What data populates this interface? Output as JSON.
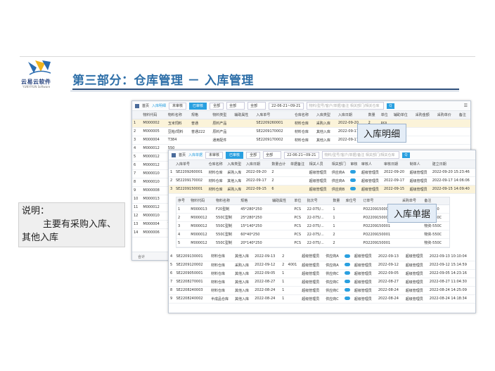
{
  "slide": {
    "title": "第三部分：仓库管理 － 入库管理",
    "logo_brand": "云易云软件",
    "logo_sub": "YUNYIYUN Software",
    "note_line1": "说明：",
    "note_line2": "主要有采购入库、",
    "note_line3": "其他入库",
    "callout_detail": "入库明细",
    "callout_doc": "入库单据"
  },
  "win1": {
    "tab_home": "首页",
    "tab_current": "入库明细",
    "btn_pending": "未审核",
    "btn_approved": "已审核",
    "btn_all": "全部",
    "sel_a": "全部",
    "sel_b": "全部",
    "date_range": "22-06-21~09-21",
    "search_placeholder": "物料/型号/客户/单据/备注  相关部门/相关仓库",
    "search_btn": "Q",
    "footer": "合计",
    "columns": [
      "",
      "物料代码",
      "物料名称",
      "规格",
      "物料类型",
      "辅助属性",
      "入库单号",
      "仓库名称",
      "入库类型",
      "入库日期",
      "数量",
      "单位",
      "辅助单位",
      "采购金额",
      "采购单价",
      "备注"
    ],
    "rows": [
      [
        "1",
        "M000002",
        "玉米饲料",
        "普通",
        "原料产品",
        "",
        "SE2209260001",
        "材料仓库",
        "采购入库",
        "2022-09-20",
        "2",
        "pcs",
        "",
        "",
        "",
        ""
      ],
      [
        "2",
        "M000005",
        "豆粕/饲料",
        "普通222",
        "原料产品",
        "",
        "SE2209170002",
        "材料仓库",
        "其他入库",
        "2022-09-17",
        "1",
        "pcs",
        "",
        "",
        "",
        ""
      ],
      [
        "3",
        "M000004",
        "T384",
        "",
        "通用配件",
        "",
        "SE2209170002",
        "材料仓库",
        "其他入库",
        "2022-09-17",
        "1",
        "kg",
        "",
        "",
        "",
        ""
      ],
      [
        "4",
        "M000012",
        "550",
        "",
        "",
        "",
        "",
        "",
        "",
        "",
        "",
        "",
        "",
        "",
        "",
        ""
      ],
      [
        "5",
        "M000012",
        "550",
        "",
        "",
        "",
        "",
        "",
        "",
        "",
        "",
        "",
        "",
        "",
        "",
        ""
      ],
      [
        "6",
        "M000012",
        "550",
        "",
        "",
        "",
        "",
        "",
        "",
        "",
        "",
        "",
        "",
        "",
        "",
        ""
      ],
      [
        "7",
        "M000010",
        "F20",
        "",
        "",
        "",
        "",
        "",
        "",
        "",
        "",
        "",
        "",
        "",
        "",
        ""
      ],
      [
        "8",
        "M000010",
        "F20",
        "",
        "",
        "",
        "",
        "",
        "",
        "",
        "",
        "",
        "",
        "",
        "",
        ""
      ],
      [
        "9",
        "M000008",
        "DS2",
        "",
        "",
        "",
        "",
        "",
        "",
        "",
        "",
        "",
        "",
        "",
        "",
        ""
      ],
      [
        "10",
        "M000013",
        "内六",
        "",
        "",
        "",
        "",
        "",
        "",
        "",
        "",
        "",
        "",
        "",
        "",
        ""
      ],
      [
        "11",
        "M000012",
        "调整",
        "",
        "",
        "",
        "",
        "",
        "",
        "",
        "",
        "",
        "",
        "",
        "",
        ""
      ],
      [
        "12",
        "M000010",
        "F20",
        "",
        "",
        "",
        "",
        "",
        "",
        "",
        "",
        "",
        "",
        "",
        "",
        ""
      ],
      [
        "13",
        "M000004",
        "T38",
        "",
        "",
        "",
        "",
        "",
        "",
        "",
        "",
        "",
        "",
        "",
        "",
        ""
      ],
      [
        "14",
        "M000006",
        "4CR",
        "",
        "",
        "",
        "",
        "",
        "",
        "",
        "",
        "",
        "",
        "",
        "",
        ""
      ]
    ]
  },
  "win2": {
    "tab_home": "首页",
    "tab_current": "入库单据",
    "btn_pending": "未审核",
    "btn_approved": "已审核",
    "btn_all": "全部",
    "sel_a": "全部",
    "date_range": "22-06-21~09-21",
    "search_placeholder": "物料/型号/客户/单据/备注  相关部门/相关仓库",
    "search_btn": "Q",
    "columns": [
      "",
      "入库单号",
      "仓库名称",
      "入库类型",
      "入库日期",
      "数量合计",
      "单据备注",
      "相关人员",
      "相关部门",
      "审核",
      "审核人",
      "审核日期",
      "制单人",
      "建立日期"
    ],
    "rows_top": [
      [
        "1",
        "SE2209260001",
        "材料仓库",
        "采购入库",
        "2022-09-20",
        "2",
        "",
        "超级管理员",
        "供应商A",
        "on",
        "超级管理员",
        "2022-09-20",
        "超级管理员",
        "2022-09-20 15:23:46"
      ],
      [
        "2",
        "SE2209170002",
        "材料仓库",
        "其他入库",
        "2022-09-17",
        "2",
        "",
        "超级管理员",
        "供应商A",
        "on",
        "超级管理员",
        "2022-09-17",
        "超级管理员",
        "2022-09-17 14:06:06"
      ],
      [
        "3",
        "SE2209150001",
        "材料仓库",
        "采购入库",
        "2022-09-15",
        "6",
        "",
        "超级管理员",
        "供应商B",
        "on",
        "超级管理员",
        "2022-09-15",
        "超级管理员",
        "2022-09-15 14:09:40"
      ]
    ],
    "sub_columns": [
      "序号",
      "物料代码",
      "物料名称",
      "规格",
      "辅助属性",
      "单位",
      "批次号",
      "数量",
      "库位号",
      "订单号",
      "采购单号",
      "备注"
    ],
    "sub_rows": [
      [
        "1",
        "M000013",
        "F20型制",
        "45*280*250",
        "",
        "PCS",
        "22-075/...",
        "1",
        "",
        "PO2209150001",
        "",
        "物资-550"
      ],
      [
        "2",
        "M000012",
        "550C型制",
        "25*280*250",
        "",
        "PCS",
        "22-075/...",
        "1",
        "",
        "PO2209150001",
        "",
        "物资-550C"
      ],
      [
        "3",
        "M000012",
        "550C型制",
        "15*140*250",
        "",
        "PCS",
        "22-075/...",
        "1",
        "",
        "PO2209150001",
        "",
        "物资-550C"
      ],
      [
        "4",
        "M000012",
        "550C型制",
        "60*40*250",
        "",
        "PCS",
        "22-075/...",
        "2",
        "",
        "PO2209150001",
        "",
        "物资-550C"
      ],
      [
        "5",
        "M000012",
        "550C型制",
        "20*140*250",
        "",
        "PCS",
        "22-075/...",
        "2",
        "",
        "PO2209150001",
        "",
        "物资-550C"
      ]
    ],
    "rows_bottom": [
      [
        "4",
        "SE2209130001",
        "材料仓库",
        "其他入库",
        "2022-09-13",
        "2",
        "",
        "超级管理员",
        "供应商A",
        "on",
        "超级管理员",
        "2022-09-13",
        "超级管理员",
        "2022-09-13 10:10:04"
      ],
      [
        "5",
        "SE2209120002",
        "材料仓库",
        "采购入库",
        "2022-09-12",
        "2",
        "4001",
        "超级管理员",
        "供应商A",
        "on",
        "超级管理员",
        "2022-09-12",
        "超级管理员",
        "2022-09-12 15:14:59"
      ],
      [
        "6",
        "SE2209050001",
        "材料仓库",
        "其他入库",
        "2022-09-05",
        "1",
        "",
        "超级管理员",
        "供应商C",
        "on",
        "超级管理员",
        "2022-09-05",
        "超级管理员",
        "2022-09-05 14:23:16"
      ],
      [
        "7",
        "SE2208270001",
        "材料仓库",
        "其他入库",
        "2022-08-27",
        "1",
        "",
        "超级管理员",
        "供应商C",
        "on",
        "超级管理员",
        "2022-08-27",
        "超级管理员",
        "2022-08-27 11:04:30"
      ],
      [
        "8",
        "SE2208240003",
        "材料仓库",
        "其他入库",
        "2022-08-24",
        "1",
        "",
        "超级管理员",
        "供应商C",
        "on",
        "超级管理员",
        "2022-08-24",
        "超级管理员",
        "2022-08-24 14:25:09"
      ],
      [
        "9",
        "SE2208240002",
        "半成品仓库",
        "其他入库",
        "2022-08-24",
        "1",
        "",
        "超级管理员",
        "供应商C",
        "on",
        "超级管理员",
        "2022-08-24",
        "超级管理员",
        "2022-08-24 14:18:34"
      ]
    ]
  }
}
